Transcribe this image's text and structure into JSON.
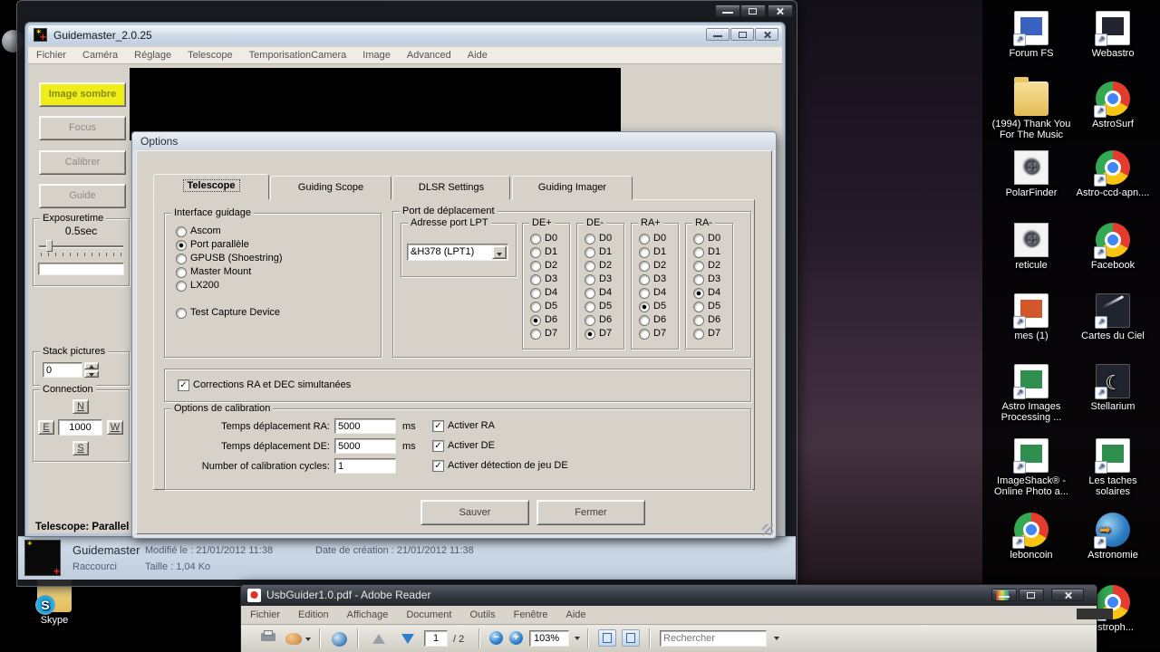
{
  "desktop": {
    "icons": [
      "Forum  FS",
      "Webastro",
      "(1994) Thank You For The Music",
      "AstroSurf",
      "PolarFinder",
      "Astro-ccd-apn....",
      "reticule",
      "Facebook",
      "mes (1)",
      "Cartes du Ciel",
      "Astro Images Processing ...",
      "Stellarium",
      "ImageShack® - Online Photo a...",
      "Les taches solaires",
      "leboncoin",
      "Astronomie",
      "astroph...",
      "Skype"
    ]
  },
  "guidemaster": {
    "title": "Guidemaster_2.0.25",
    "menus": [
      "Fichier",
      "Caméra",
      "Réglage",
      "Telescope",
      "TemporisationCamera",
      "Image",
      "Advanced",
      "Aide"
    ],
    "sidebar": {
      "dark_button": "Image sombre",
      "focus_button": "Focus",
      "calibrate_button": "Calibrer",
      "guide_button": "Guide",
      "exposure_label": "Exposuretime",
      "exposure_value": "0.5sec",
      "stack_label": "Stack pictures",
      "stack_value": "0",
      "connection_label": "Connection",
      "north": "N",
      "east": "E",
      "west": "W",
      "south": "S",
      "duration_value": "1000",
      "status": "Telescope: Parallel"
    }
  },
  "options_dialog": {
    "title": "Options",
    "tabs": [
      "Telescope",
      "Guiding Scope",
      "DLSR Settings",
      "Guiding Imager"
    ],
    "active_tab": "Telescope",
    "interface_guidage": {
      "label": "Interface guidage",
      "options": [
        "Ascom",
        "Port parallèle",
        "GPUSB (Shoestring)",
        "Master Mount",
        "LX200",
        "Test Capture Device"
      ],
      "selected": "Port parallèle"
    },
    "port_deplacement": {
      "label": "Port de déplacement",
      "adresse_label": "Adresse port LPT",
      "adresse_value": "&H378 (LPT1)",
      "pins": [
        "D0",
        "D1",
        "D2",
        "D3",
        "D4",
        "D5",
        "D6",
        "D7"
      ],
      "columns": [
        {
          "label": "DE+",
          "selected": "D6"
        },
        {
          "label": "DE-",
          "selected": "D7"
        },
        {
          "label": "RA+",
          "selected": "D5"
        },
        {
          "label": "RA-",
          "selected": "D4"
        }
      ]
    },
    "corrections_label": "Corrections RA et DEC simultanées",
    "corrections_checked": true,
    "calibration": {
      "label": "Options de calibration",
      "rows": [
        {
          "label": "Temps déplacement RA:",
          "value": "5000",
          "unit": "ms",
          "check": "Activer RA",
          "checked": true
        },
        {
          "label": "Temps déplacement DE:",
          "value": "5000",
          "unit": "ms",
          "check": "Activer DE",
          "checked": true
        },
        {
          "label": "Number of calibration cycles:",
          "value": "1",
          "unit": "",
          "check": "Activer détection de jeu DE",
          "checked": true
        }
      ]
    },
    "buttons": {
      "save": "Sauver",
      "close": "Fermer"
    }
  },
  "file_info": {
    "name": "Guidemaster",
    "modified": "Modifié le : 21/01/2012 11:38",
    "created": "Date de création : 21/01/2012 11:38",
    "type": "Raccourci",
    "size": "Taille : 1,04 Ko"
  },
  "adobe_reader": {
    "title": "UsbGuider1.0.pdf - Adobe Reader",
    "menus": [
      "Fichier",
      "Edition",
      "Affichage",
      "Document",
      "Outils",
      "Fenêtre",
      "Aide"
    ],
    "page_value": "1",
    "page_total": "/ 2",
    "zoom_value": "103%",
    "search_placeholder": "Rechercher"
  }
}
